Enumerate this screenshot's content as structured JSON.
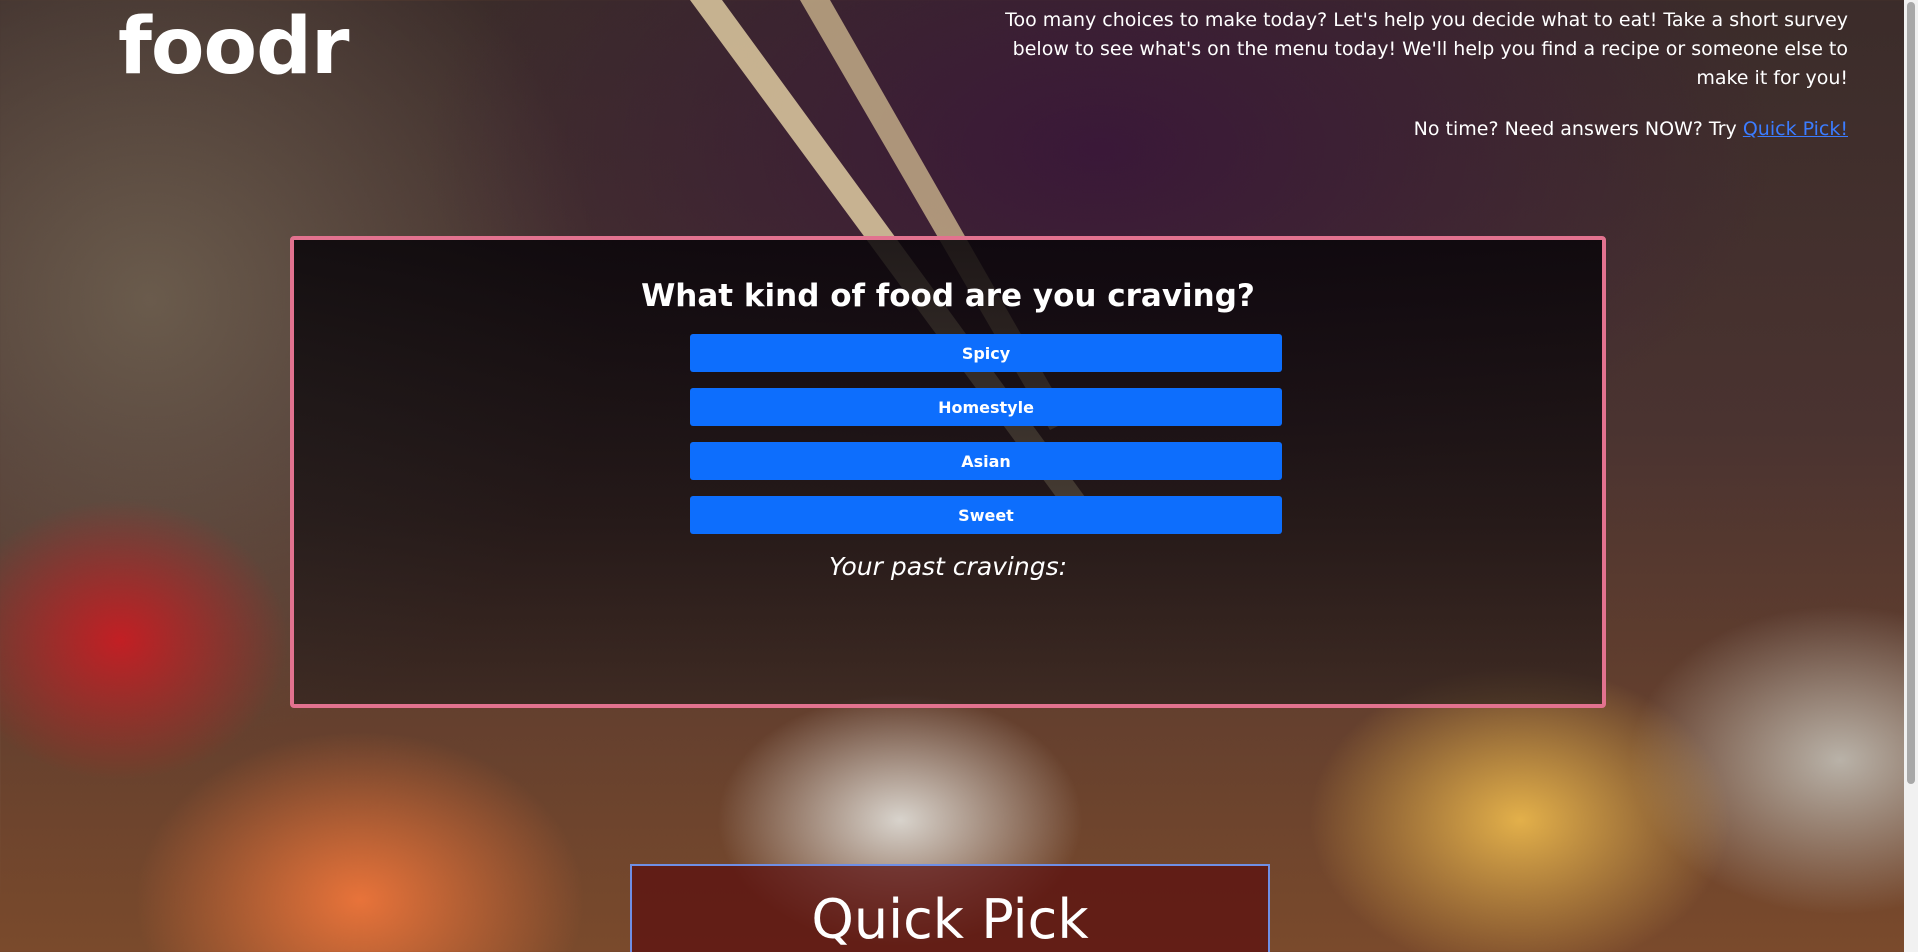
{
  "header": {
    "logo": "foodr",
    "intro": "Too many choices to make today? Let's help you decide what to eat! Take a short survey below to see what's on the menu today! We'll help you find a recipe or someone else to make it for you!",
    "quick_prompt": "No time? Need answers NOW? Try ",
    "quick_link": "Quick Pick!"
  },
  "survey": {
    "question": "What kind of food are you craving?",
    "choices": [
      "Spicy",
      "Homestyle",
      "Asian",
      "Sweet"
    ],
    "past_label": "Your past cravings:"
  },
  "quick_pick": {
    "title": "Quick Pick"
  },
  "colors": {
    "button": "#0d6efd",
    "survey_border": "#e2728f",
    "quick_pick_border": "#6f8fe6",
    "link": "#3b7cff"
  }
}
